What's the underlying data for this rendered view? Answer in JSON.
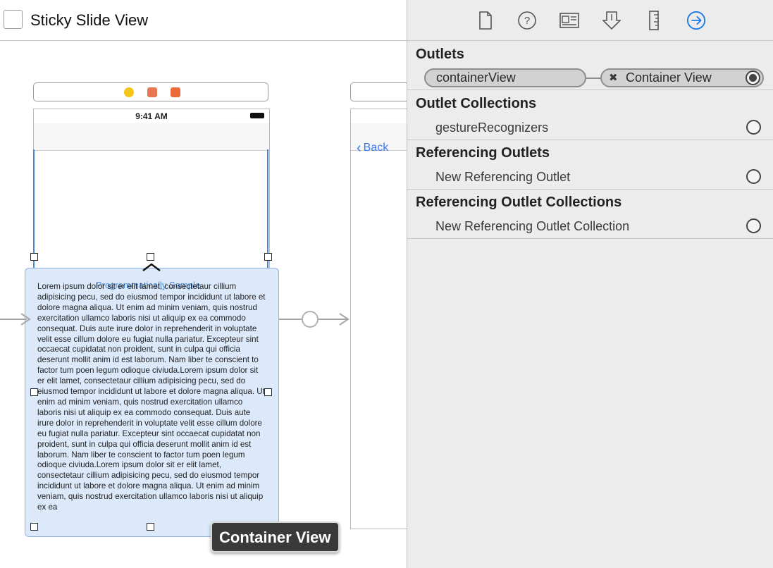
{
  "canvas": {
    "scene_title": "Sticky Slide View",
    "status_time": "9:41 AM",
    "overlay_label": "Programmatically Sample",
    "lorem_text": "Lorem ipsum dolor sit er elit lamet, consectetaur cillium adipisicing pecu, sed do eiusmod tempor incididunt ut labore et dolore magna aliqua. Ut enim ad minim veniam, quis nostrud exercitation ullamco laboris nisi ut aliquip ex ea commodo consequat. Duis aute irure dolor in reprehenderit in voluptate velit esse cillum dolore eu fugiat nulla pariatur. Excepteur sint occaecat cupidatat non proident, sunt in culpa qui officia deserunt mollit anim id est laborum. Nam liber te conscient to factor tum poen legum odioque civiuda.Lorem ipsum dolor sit er elit lamet, consectetaur cillium adipisicing pecu, sed do eiusmod tempor incididunt ut labore et dolore magna aliqua. Ut enim ad minim veniam, quis nostrud exercitation ullamco laboris nisi ut aliquip ex ea commodo consequat. Duis aute irure dolor in reprehenderit in voluptate velit esse cillum dolore eu fugiat nulla pariatur. Excepteur sint occaecat cupidatat non proident, sunt in culpa qui officia deserunt mollit anim id est laborum. Nam liber te conscient to factor tum poen legum odioque civiuda.Lorem ipsum dolor sit er elit lamet, consectetaur cillium adipisicing pecu, sed do eiusmod tempor incididunt ut labore et dolore magna aliqua. Ut enim ad minim veniam, quis nostrud exercitation ullamco laboris nisi ut aliquip ex ea",
    "back_label": "Back",
    "tooltip": "Container View"
  },
  "inspector": {
    "toolbar_icons": [
      "file-inspector-icon",
      "quick-help-icon",
      "identity-inspector-icon",
      "attributes-inspector-icon",
      "size-inspector-icon",
      "connections-inspector-icon"
    ],
    "outlets": {
      "title": "Outlets",
      "name": "containerView",
      "target": "Container View"
    },
    "outlet_collections": {
      "title": "Outlet Collections",
      "item": "gestureRecognizers"
    },
    "referencing_outlets": {
      "title": "Referencing Outlets",
      "item": "New Referencing Outlet"
    },
    "referencing_outlet_collections": {
      "title": "Referencing Outlet Collections",
      "item": "New Referencing Outlet Collection"
    }
  },
  "colors": {
    "accent": "#3478f6",
    "selection": "#dbe9fb"
  }
}
